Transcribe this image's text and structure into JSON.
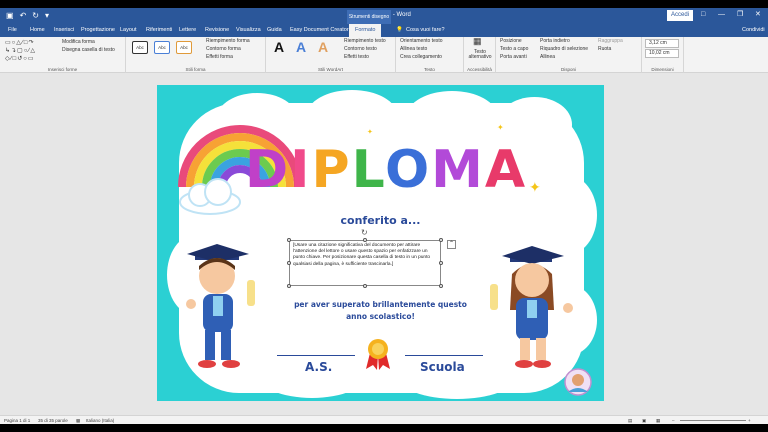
{
  "window": {
    "title": "Documento2 - Word",
    "context_group": "Strumenti disegno",
    "sign_in": "Accedi",
    "share": "Condividi"
  },
  "tabs": [
    "File",
    "Home",
    "Inserisci",
    "Progettazione",
    "Layout",
    "Riferimenti",
    "Lettere",
    "Revisione",
    "Visualizza",
    "Guida",
    "Easy Document Creator",
    "Formato",
    "Cosa vuoi fare?"
  ],
  "ribbon": {
    "insert_shapes": {
      "label": "Inserisci forme",
      "edit_shape": "Modifica forma",
      "draw_textbox": "Disegna casella di testo"
    },
    "shape_styles": {
      "label": "Stili forma",
      "sample": "Abc",
      "fill": "Riempimento forma",
      "outline": "Contorno forma",
      "effects": "Effetti forma"
    },
    "wordart": {
      "label": "Stili WordArt"
    },
    "text": {
      "label": "Testo",
      "fill": "Riempimento testo",
      "outline": "Contorno testo",
      "effects": "Effetti testo",
      "direction": "Orientamento testo",
      "align": "Allinea testo",
      "link": "Crea collegamento"
    },
    "accessibility": {
      "label": "Accessibilità",
      "alt_text": "Testo alternativo"
    },
    "arrange": {
      "label": "Disponi",
      "position": "Posizione",
      "wrap": "Testo a capo",
      "forward": "Porta avanti",
      "backward": "Porta indietro",
      "selection_pane": "Riquadro di selezione",
      "align": "Allinea",
      "group": "Raggruppa",
      "rotate": "Ruota"
    },
    "size": {
      "label": "Dimensioni",
      "height": "3,12 cm",
      "width": "10,02 cm"
    }
  },
  "document": {
    "title_letters": [
      "D",
      "I",
      "P",
      "L",
      "O",
      "M",
      "A"
    ],
    "title_colors": [
      "#c040c8",
      "#f04a8a",
      "#f5a623",
      "#3fb54a",
      "#3a6fd8",
      "#b24ad8",
      "#e83a6a"
    ],
    "conferito": "conferito a...",
    "textbox_text": "[Usare una citazione significativa del documento per attirare l'attenzione del lettore o usare questo spazio per enfatizzare un punto chiave. Per posizionare questa casella di testo in un punto qualsiasi della pagina, è sufficiente trascinarla.]",
    "subtitle_line1": "per aver superato brillantemente questo",
    "subtitle_line2": "anno scolastico!",
    "sig_left": "A.S.",
    "sig_right": "Scuola"
  },
  "status": {
    "page": "Pagina 1 di 1",
    "words": "35 di 35 parole",
    "language": "Italiano (Italia)"
  },
  "colors": {
    "ribbon_blue": "#2b579a",
    "page_bg": "#2bd0d3",
    "text_blue": "#2a4a9a"
  }
}
